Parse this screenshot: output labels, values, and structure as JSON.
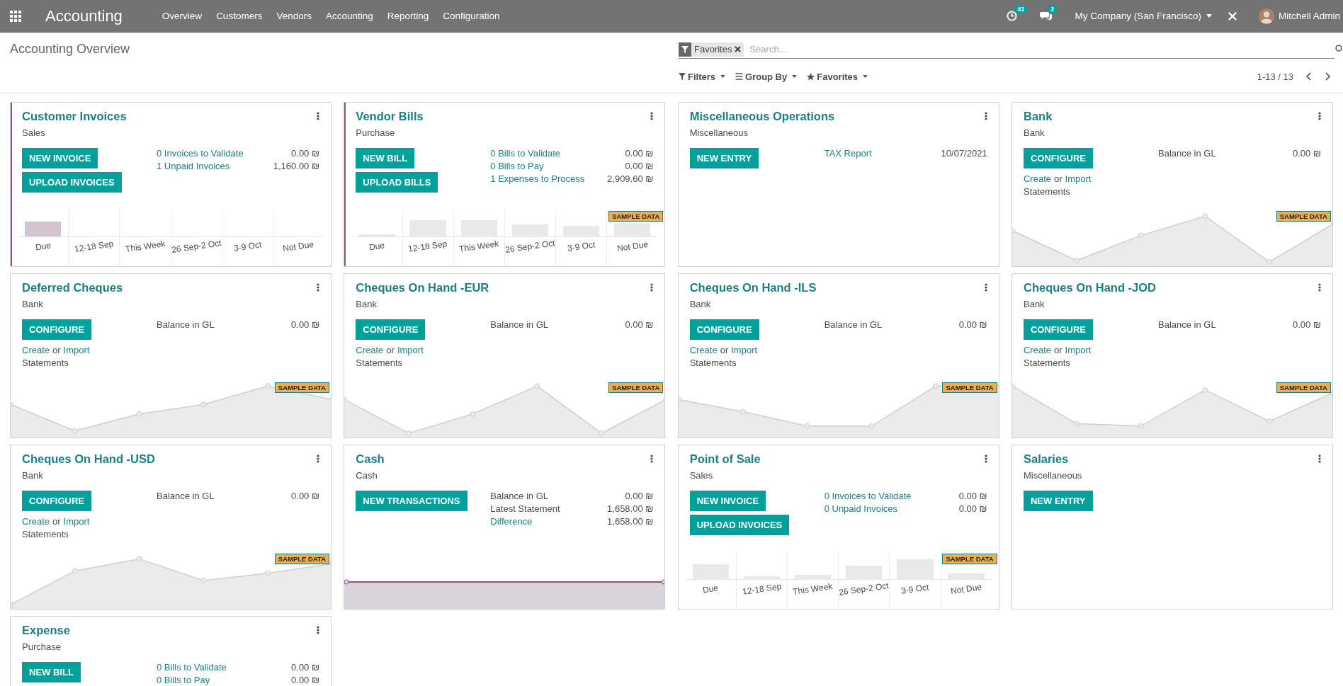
{
  "navbar": {
    "app_name": "Accounting",
    "menu": [
      "Overview",
      "Customers",
      "Vendors",
      "Accounting",
      "Reporting",
      "Configuration"
    ],
    "activity_count": "41",
    "message_count": "2",
    "company": "My Company (San Francisco)",
    "user": "Mitchell Admin"
  },
  "control_panel": {
    "breadcrumb": "Accounting Overview",
    "facet": "Favorites",
    "search": {
      "placeholder": "Search..."
    },
    "dropdowns": [
      {
        "kind": "filter",
        "label": "Filters"
      },
      {
        "kind": "group",
        "label": "Group By"
      },
      {
        "kind": "favorite",
        "label": "Favorites"
      }
    ],
    "pager": "1-13 / 13"
  },
  "cards": [
    {
      "title": "Customer Invoices",
      "subtitle": "Sales",
      "color": "#875a7b",
      "buttons": [
        "NEW INVOICE",
        "UPLOAD INVOICES"
      ],
      "stats": [
        {
          "label": "0 Invoices to Validate",
          "value": "0.00 ₪",
          "link": true
        },
        {
          "label": "1 Unpaid Invoices",
          "value": "1,160.00 ₪",
          "link": true
        }
      ],
      "graph": {
        "kind": "bar",
        "sample": false,
        "labels": [
          "Due",
          "12-18 Sep",
          "This Week",
          "26 Sep-2 Oct",
          "3-9 Oct",
          "Not Due"
        ]
      }
    },
    {
      "title": "Vendor Bills",
      "subtitle": "Purchase",
      "color": "#875a7b",
      "buttons": [
        "NEW BILL",
        "UPLOAD BILLS"
      ],
      "stats": [
        {
          "label": "0 Bills to Validate",
          "value": "0.00 ₪",
          "link": true
        },
        {
          "label": "0 Bills to Pay",
          "value": "0.00 ₪",
          "link": true
        },
        {
          "label": "1 Expenses to Process",
          "value": "2,909.60 ₪",
          "link": true
        }
      ],
      "graph": {
        "kind": "bar",
        "sample": true,
        "badge": "SAMPLE DATA",
        "labels": [
          "Due",
          "12-18 Sep",
          "This Week",
          "26 Sep-2 Oct",
          "3-9 Oct",
          "Not Due"
        ]
      }
    },
    {
      "title": "Miscellaneous Operations",
      "subtitle": "Miscellaneous",
      "buttons": [
        "NEW ENTRY"
      ],
      "stats": [
        {
          "label": "TAX Report",
          "value": "10/07/2021",
          "link": true
        }
      ]
    },
    {
      "title": "Bank",
      "subtitle": "Bank",
      "buttons": [
        "CONFIGURE"
      ],
      "stats": [
        {
          "label": "Balance in GL",
          "value": "0.00 ₪",
          "link": false
        }
      ],
      "statements": {
        "create": "Create",
        "or": "or",
        "import": "Import",
        "tail": "Statements"
      },
      "graph": {
        "kind": "line",
        "sample": true,
        "badge": "SAMPLE DATA"
      }
    },
    {
      "title": "Deferred Cheques",
      "subtitle": "Bank",
      "buttons": [
        "CONFIGURE"
      ],
      "stats": [
        {
          "label": "Balance in GL",
          "value": "0.00 ₪",
          "link": false
        }
      ],
      "statements": {
        "create": "Create",
        "or": "or",
        "import": "Import",
        "tail": "Statements"
      },
      "graph": {
        "kind": "line",
        "sample": true,
        "badge": "SAMPLE DATA"
      }
    },
    {
      "title": "Cheques On Hand -EUR",
      "subtitle": "Bank",
      "buttons": [
        "CONFIGURE"
      ],
      "stats": [
        {
          "label": "Balance in GL",
          "value": "0.00 ₪",
          "link": false
        }
      ],
      "statements": {
        "create": "Create",
        "or": "or",
        "import": "Import",
        "tail": "Statements"
      },
      "graph": {
        "kind": "line",
        "sample": true,
        "badge": "SAMPLE DATA"
      }
    },
    {
      "title": "Cheques On Hand -ILS",
      "subtitle": "Bank",
      "buttons": [
        "CONFIGURE"
      ],
      "stats": [
        {
          "label": "Balance in GL",
          "value": "0.00 ₪",
          "link": false
        }
      ],
      "statements": {
        "create": "Create",
        "or": "or",
        "import": "Import",
        "tail": "Statements"
      },
      "graph": {
        "kind": "line",
        "sample": true,
        "badge": "SAMPLE DATA"
      }
    },
    {
      "title": "Cheques On Hand -JOD",
      "subtitle": "Bank",
      "buttons": [
        "CONFIGURE"
      ],
      "stats": [
        {
          "label": "Balance in GL",
          "value": "0.00 ₪",
          "link": false
        }
      ],
      "statements": {
        "create": "Create",
        "or": "or",
        "import": "Import",
        "tail": "Statements"
      },
      "graph": {
        "kind": "line",
        "sample": true,
        "badge": "SAMPLE DATA"
      }
    },
    {
      "title": "Cheques On Hand -USD",
      "subtitle": "Bank",
      "buttons": [
        "CONFIGURE"
      ],
      "stats": [
        {
          "label": "Balance in GL",
          "value": "0.00 ₪",
          "link": false
        }
      ],
      "statements": {
        "create": "Create",
        "or": "or",
        "import": "Import",
        "tail": "Statements"
      },
      "graph": {
        "kind": "line",
        "sample": true,
        "badge": "SAMPLE DATA"
      }
    },
    {
      "title": "Cash",
      "subtitle": "Cash",
      "buttons": [
        "NEW TRANSACTIONS"
      ],
      "stats": [
        {
          "label": "Balance in GL",
          "value": "0.00 ₪",
          "link": false
        },
        {
          "label": "Latest Statement",
          "value": "1,658.00 ₪",
          "link": false
        },
        {
          "label": "Difference",
          "value": "1,658.00 ₪",
          "link": true
        }
      ],
      "graph": {
        "kind": "flat"
      }
    },
    {
      "title": "Point of Sale",
      "subtitle": "Sales",
      "buttons": [
        "NEW INVOICE",
        "UPLOAD INVOICES"
      ],
      "stats": [
        {
          "label": "0 Invoices to Validate",
          "value": "0.00 ₪",
          "link": true
        },
        {
          "label": "0 Unpaid Invoices",
          "value": "0.00 ₪",
          "link": true
        }
      ],
      "graph": {
        "kind": "bar",
        "sample": true,
        "badge": "SAMPLE DATA",
        "labels": [
          "Due",
          "12-18 Sep",
          "This Week",
          "26 Sep-2 Oct",
          "3-9 Oct",
          "Not Due"
        ]
      }
    },
    {
      "title": "Salaries",
      "subtitle": "Miscellaneous",
      "buttons": [
        "NEW ENTRY"
      ]
    },
    {
      "title": "Expense",
      "subtitle": "Purchase",
      "buttons": [
        "NEW BILL"
      ],
      "stats": [
        {
          "label": "0 Bills to Validate",
          "value": "0.00 ₪",
          "link": true
        },
        {
          "label": "0 Bills to Pay",
          "value": "0.00 ₪",
          "link": true
        }
      ]
    }
  ]
}
